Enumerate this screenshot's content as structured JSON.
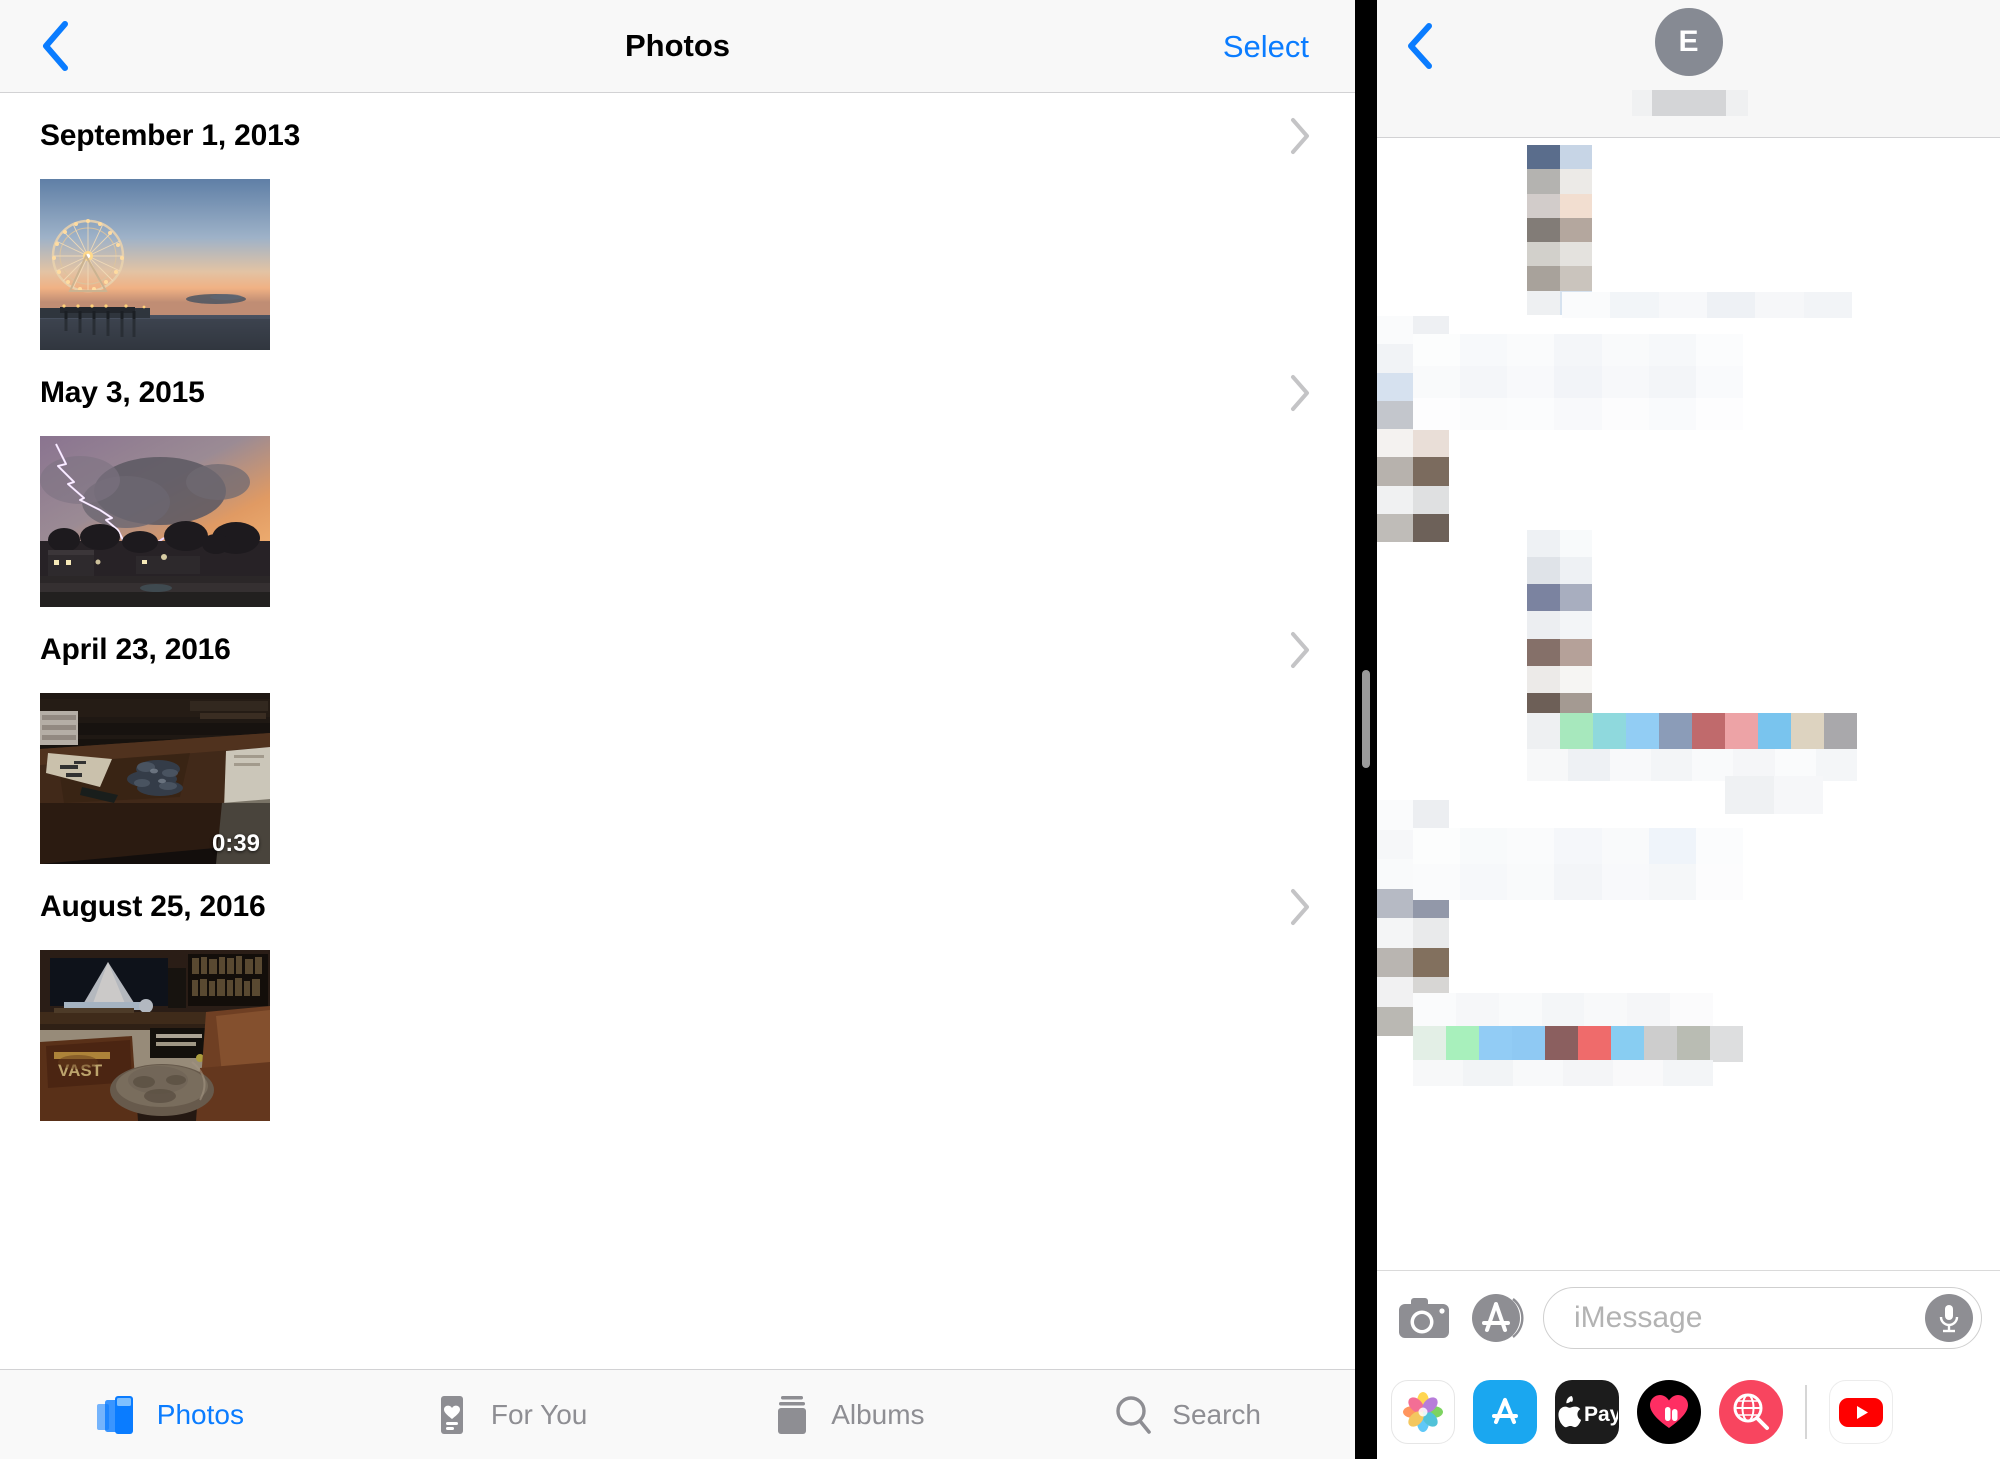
{
  "photos_app": {
    "nav": {
      "back_icon": "chevron-left-icon",
      "title": "Photos",
      "select_label": "Select"
    },
    "moments": [
      {
        "date": "September 1, 2013",
        "chevron": "chevron-right-icon",
        "thumbnail": {
          "description": "Ferris wheel on a pier at sunset over water",
          "type": "photo",
          "duration": ""
        }
      },
      {
        "date": "May 3, 2015",
        "chevron": "chevron-right-icon",
        "thumbnail": {
          "description": "Lightning bolt striking from storm clouds at dusk over suburban houses",
          "type": "photo",
          "duration": ""
        }
      },
      {
        "date": "April 23, 2016",
        "chevron": "chevron-right-icon",
        "thumbnail": {
          "description": "Wooden workbench desk with scattered dark metal parts and paper",
          "type": "video",
          "duration": "0:39"
        }
      },
      {
        "date": "August 25, 2016",
        "chevron": "chevron-right-icon",
        "thumbnail": {
          "description": "Living room with bright projector screen, VAST board game box, bookshelf and cat on a blanket",
          "type": "photo",
          "duration": ""
        }
      }
    ],
    "tabs": [
      {
        "label": "Photos",
        "icon": "photos-stack-icon",
        "active": true
      },
      {
        "label": "For You",
        "icon": "for-you-heart-card-icon",
        "active": false
      },
      {
        "label": "Albums",
        "icon": "albums-stack-icon",
        "active": false
      },
      {
        "label": "Search",
        "icon": "magnifier-icon",
        "active": false
      }
    ],
    "colors": {
      "accent": "#0a7cff",
      "inactive": "#8e8e93",
      "nav_background": "#f8f8f8"
    }
  },
  "split_divider": {
    "handle_name": "split-view-drag-handle",
    "color": "#000000"
  },
  "messages_app": {
    "header": {
      "back_icon": "chevron-left-icon",
      "avatar_initial": "E",
      "avatar_color": "#868a93",
      "contact_name": ""
    },
    "thread": {
      "redacted": true,
      "note": "All message bubbles are pixelated / blurred out"
    },
    "composer": {
      "camera_icon": "camera-icon",
      "app_store_icon": "app-store-icon",
      "input_placeholder": "iMessage",
      "input_value": "",
      "mic_icon": "microphone-icon"
    },
    "app_drawer": [
      {
        "name": "photos-app-icon",
        "label": "Photos",
        "color": "#ffffff"
      },
      {
        "name": "app-store-app-icon",
        "label": "App Store",
        "color": "#1aa7f0"
      },
      {
        "name": "apple-pay-app-icon",
        "label": "Apple Pay",
        "color": "#1c1c1c"
      },
      {
        "name": "digital-touch-app-icon",
        "label": "Digital Touch",
        "color": "#000000"
      },
      {
        "name": "images-search-app-icon",
        "label": "#images",
        "color": "#f8455f"
      },
      {
        "name": "youtube-app-icon",
        "label": "YouTube",
        "color": "#ffffff"
      }
    ]
  }
}
